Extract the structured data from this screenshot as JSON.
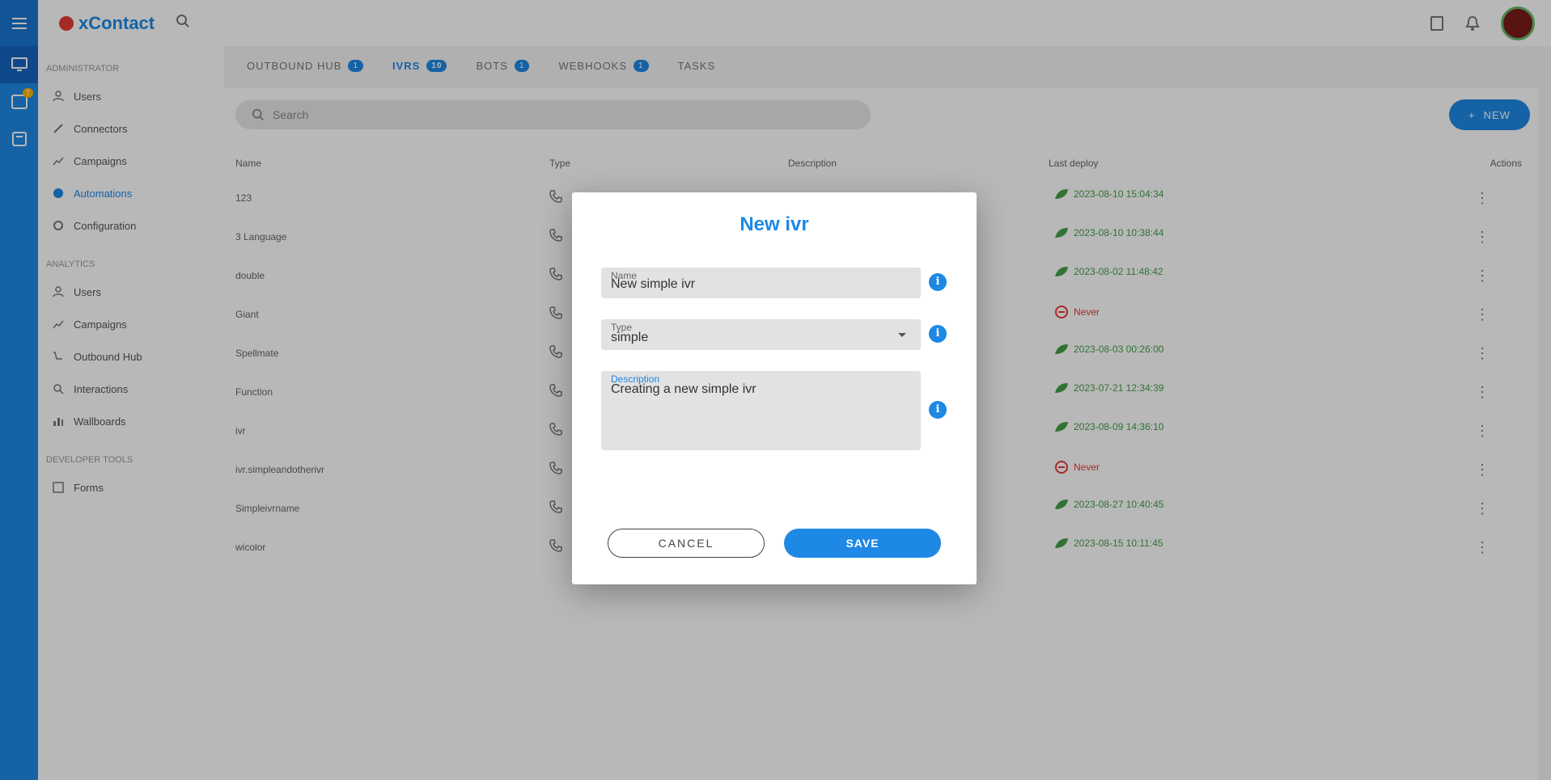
{
  "app": {
    "logo_text": "xContact"
  },
  "sidebar": {
    "section_admin": "Administrator",
    "admin_items": [
      "Users",
      "Connectors",
      "Campaigns",
      "Automations",
      "Configuration"
    ],
    "section_analytics": "Analytics",
    "analytics_items": [
      "Users",
      "Campaigns",
      "Outbound Hub",
      "Interactions",
      "Wallboards"
    ],
    "section_developer": "Developer Tools",
    "developer_items": [
      "Forms"
    ],
    "notification_badge": "7"
  },
  "tabs": [
    {
      "label": "Outbound Hub",
      "count": "1"
    },
    {
      "label": "IVRs",
      "count": "10"
    },
    {
      "label": "Bots",
      "count": "1"
    },
    {
      "label": "Webhooks",
      "count": "1"
    },
    {
      "label": "Tasks",
      "count": ""
    }
  ],
  "toolbar": {
    "search_placeholder": "Search",
    "new_label": "NEW"
  },
  "table": {
    "headers": [
      "Name",
      "Type",
      "Description",
      "Last deploy",
      "Actions"
    ],
    "rows": [
      {
        "name": "123",
        "updated": "2023-08-10 15:04:34",
        "status": "ok"
      },
      {
        "name": "3 Language",
        "updated": "2023-08-10 10:38:44",
        "status": "ok"
      },
      {
        "name": "double",
        "updated": "2023-08-02 11:48:42",
        "status": "ok"
      },
      {
        "name": "Giant",
        "updated": "Never",
        "status": "err"
      },
      {
        "name": "Spellmate",
        "updated": "2023-08-03 00:26:00",
        "status": "ok"
      },
      {
        "name": "Function",
        "updated": "2023-07-21 12:34:39",
        "status": "ok"
      },
      {
        "name": "ivr",
        "updated": "2023-08-09 14:36:10",
        "status": "ok"
      },
      {
        "name": "ivr.simpleandotherivr",
        "updated": "Never",
        "status": "err"
      },
      {
        "name": "Simpleivrname",
        "updated": "2023-08-27 10:40:45",
        "status": "ok"
      },
      {
        "name": "wicolor",
        "updated": "2023-08-15 10:11:45",
        "status": "ok"
      }
    ]
  },
  "dialog": {
    "title": "New ivr",
    "name_label": "Name",
    "name_value": "New simple ivr",
    "type_label": "Type",
    "type_value": "simple",
    "description_label": "Description",
    "description_value": "Creating a new simple ivr",
    "info_glyph": "i",
    "cancel_label": "CANCEL",
    "save_label": "SAVE"
  },
  "colors": {
    "accent": "#1e88e5",
    "success": "#43a047",
    "error": "#e53935"
  }
}
